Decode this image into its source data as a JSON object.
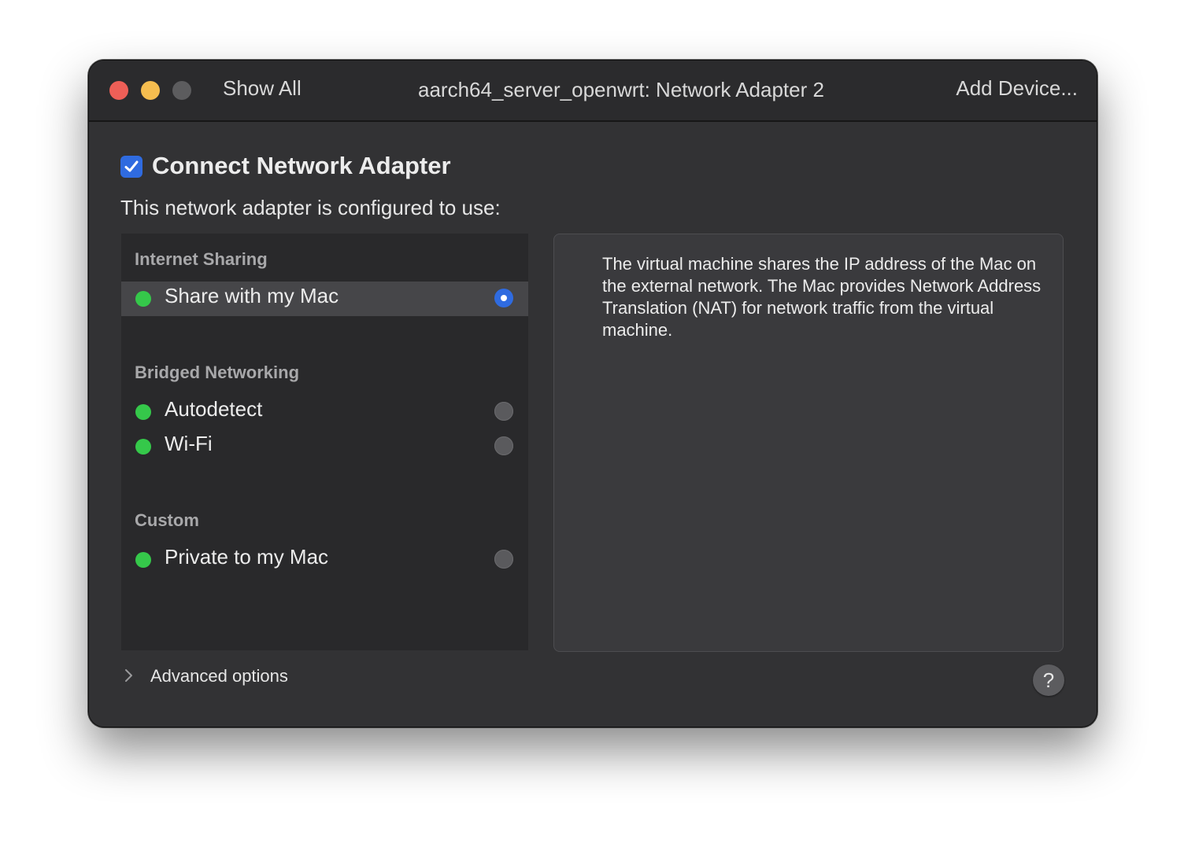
{
  "window": {
    "title": "aarch64_server_openwrt: Network Adapter 2",
    "traffic_lights": {
      "close_color": "#ed5f57",
      "minimize_color": "#f5bd4f",
      "zoom_color": "#5c5c5e"
    },
    "toolbar": {
      "show_all_label": "Show All",
      "add_device_label": "Add Device..."
    }
  },
  "settings": {
    "connect_label": "Connect Network Adapter",
    "connect_checked": true,
    "configured_label": "This network adapter is configured to use:",
    "sections": [
      {
        "header": "Internet Sharing",
        "items": [
          {
            "label": "Share with my Mac",
            "selected": true,
            "status_color": "#35c84a"
          }
        ]
      },
      {
        "header": "Bridged Networking",
        "items": [
          {
            "label": "Autodetect",
            "selected": false,
            "status_color": "#35c84a"
          },
          {
            "label": "Wi-Fi",
            "selected": false,
            "status_color": "#35c84a"
          }
        ]
      },
      {
        "header": "Custom",
        "items": [
          {
            "label": "Private to my Mac",
            "selected": false,
            "status_color": "#35c84a"
          }
        ]
      }
    ],
    "description": "The virtual machine shares the IP address of the Mac on the external network. The Mac provides Network Address Translation (NAT) for network traffic from the virtual machine.",
    "advanced_label": "Advanced options",
    "help_label": "?"
  },
  "icons": {
    "checkbox": "checkmark-icon",
    "chevron": "chevron-right-icon",
    "help": "question-mark-icon"
  },
  "colors": {
    "accent": "#2f6be0",
    "status_online": "#35c84a",
    "window_bg": "#323234",
    "titlebar_bg": "#2b2b2d"
  }
}
